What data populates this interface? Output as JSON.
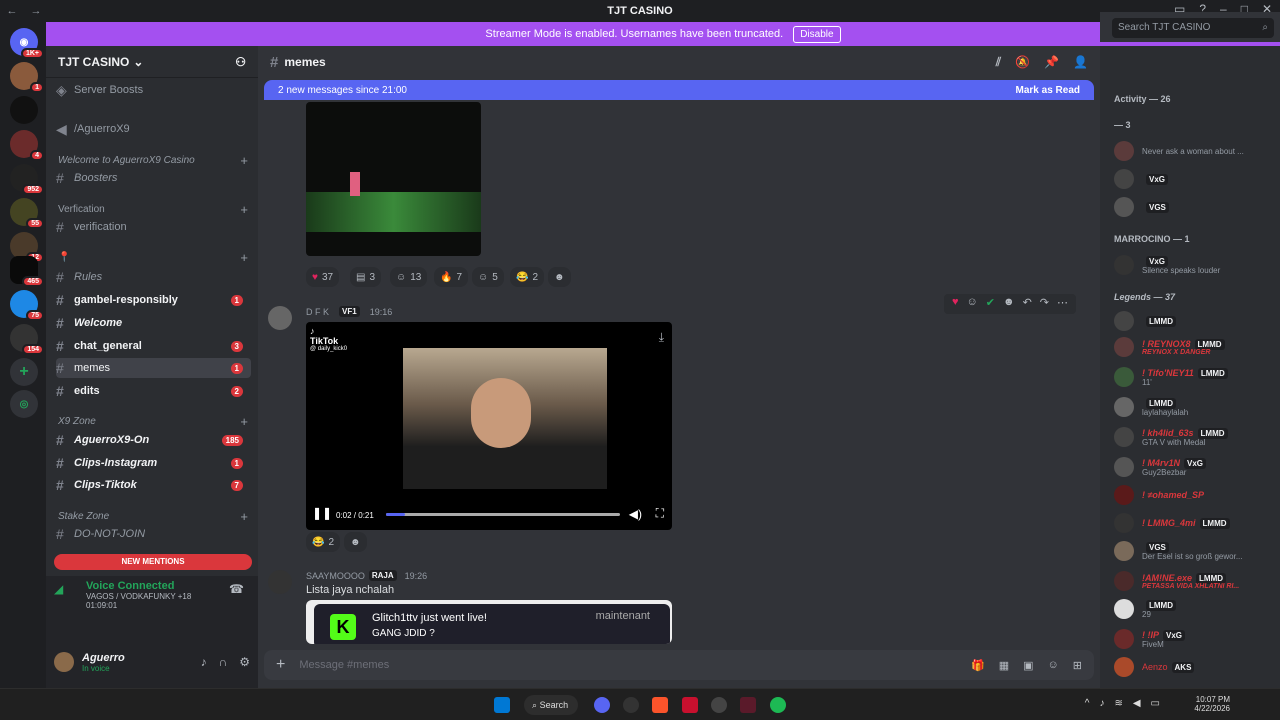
{
  "window": {
    "title": "TJT CASINO"
  },
  "banner": {
    "text": "Streamer Mode is enabled. Usernames have been truncated.",
    "button": "Disable"
  },
  "server": {
    "name": "TJT CASINO"
  },
  "server_badges": [
    "1K+",
    "1",
    "4",
    "952",
    "55",
    "12",
    "465",
    "75",
    "154"
  ],
  "channels": {
    "server_boosts": "Server Boosts",
    "aguerro": "/AguerroX9",
    "cat_welcome": "Welcome to AguerroX9 Casino",
    "boosters": "Boosters",
    "cat_verif": "Verfication",
    "verification": "verification",
    "rules": "Rules",
    "gambel": "gambel-responsibly",
    "gambel_count": "1",
    "welcome": "Welcome",
    "chat_general": "chat_general",
    "chat_count": "3",
    "memes": "memes",
    "memes_count": "1",
    "edits": "edits",
    "edits_count": "2",
    "cat_x9": "X9 Zone",
    "aguerro_on": "AguerroX9-On",
    "aguerro_on_count": "185",
    "clips_insta": "Clips-Instagram",
    "clips_insta_count": "1",
    "clips_tiktok": "Clips-Tiktok",
    "clips_tiktok_count": "7",
    "cat_stake": "Stake Zone",
    "dnj": "DO-NOT-JOIN",
    "new_mentions": "NEW MENTIONS"
  },
  "voice": {
    "status": "Voice Connected",
    "channel": "VAGOS / VODKAFUNKY +18",
    "timer": "01:09:01"
  },
  "user": {
    "name": "Aguerro",
    "status": "In voice"
  },
  "main": {
    "channel": "memes",
    "new_bar": "2 new messages since 21:00",
    "mark_read": "Mark as Read",
    "reactions1": [
      "37",
      "3",
      "13",
      "7",
      "5",
      "2"
    ],
    "msg1": {
      "author": "D F K",
      "badge": "VF1",
      "time": "19:16"
    },
    "video": {
      "brand": "TikTok",
      "handle": "@ daily_kick0",
      "time": "0:02 / 0:21",
      "progress": 0.08
    },
    "reactions2": [
      "2"
    ],
    "msg2": {
      "author": "SAAYMOOOO",
      "badge": "RAJA",
      "time": "19:26",
      "text": "Lista jaya nchalah"
    },
    "embed": {
      "title": "Glitch1ttv just went live!",
      "sub": "GANG JDID ?",
      "right": "maintenant"
    },
    "composer": "Message #memes"
  },
  "members": {
    "search": "Search TJT CASINO",
    "activity": "Activity — 26",
    "sec1": "— 3",
    "m1_status": "Never ask a woman about ...",
    "m2_tag": "VxG",
    "m3_tag": "VGS",
    "sec_marrocino": "MARROCINO — 1",
    "m4_tag": "VxG",
    "m4_status": "Silence speaks louder",
    "sec_legends": "Legends — 37",
    "l1_tag": "LMMD",
    "l2_name": "! REYNOX8",
    "l2_tag": "LMMD",
    "l2_status": "REYNOX X DANGER",
    "l3_name": "! Tifo'NEY11",
    "l3_tag": "LMMD",
    "l3_status": "11'",
    "l4_tag": "LMMD",
    "l4_status": "laylahaylalah",
    "l5_name": "! kh4lid_63s",
    "l5_tag": "LMMD",
    "l5_status": "GTA V with Medal",
    "l6_name": "! M4rv1N",
    "l6_tag": "VxG",
    "l6_status": "Guy2Bezbar",
    "l7_name": "! ≠ohamed_SP",
    "l8_name": "! LMMG_4mi",
    "l8_tag": "LMMD",
    "l9_tag": "VGS",
    "l9_status": "Der Esel ist so groß gewor...",
    "l10_name": "!AM!NE.exe",
    "l10_tag": "LMMD",
    "l10_status": "PETASSA VIDA XHLATNI RI...",
    "l11_tag": "LMMD",
    "l11_status": "29",
    "l12_name": "! !IP",
    "l12_tag": "VxG",
    "l12_status": "FiveM",
    "l13_name": "Aenzo",
    "l13_tag": "AKS"
  },
  "taskbar": {
    "search": "Search",
    "time": "10:07 PM",
    "date": "4/22/2026"
  }
}
